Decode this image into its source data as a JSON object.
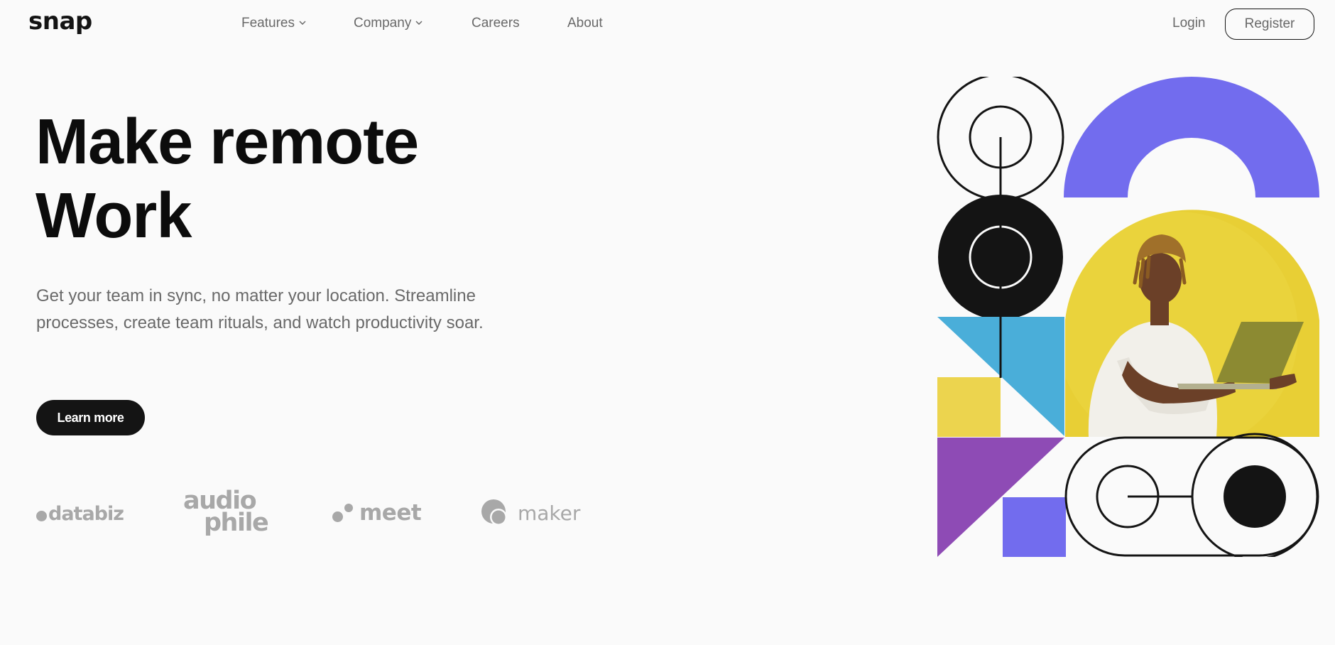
{
  "brand": {
    "logo_text": "snap"
  },
  "nav": {
    "features_label": "Features",
    "company_label": "Company",
    "careers_label": "Careers",
    "about_label": "About"
  },
  "auth": {
    "login_label": "Login",
    "register_label": "Register"
  },
  "hero": {
    "title_line1": "Make remote",
    "title_line2": "Work",
    "description": "Get your team in sync, no matter your location. Streamline processes, create team rituals, and watch productivity soar.",
    "cta_label": "Learn more"
  },
  "clients": {
    "databiz": "databiz",
    "audiophile_line1": "audio",
    "audiophile_line2": "phile",
    "meet": "meet",
    "maker": "maker"
  },
  "icons": [
    "chevron-down-icon",
    "databiz-logo",
    "audiophile-logo",
    "meet-logo",
    "maker-logo"
  ],
  "colors": {
    "background": "#fafafa",
    "text_dark": "#141414",
    "text_gray": "#696969",
    "client_gray": "#a8a8a8",
    "purple": "#726cee",
    "blue": "#4aaed9",
    "yellow": "#ecd44e",
    "violet": "#8e4bb5"
  }
}
